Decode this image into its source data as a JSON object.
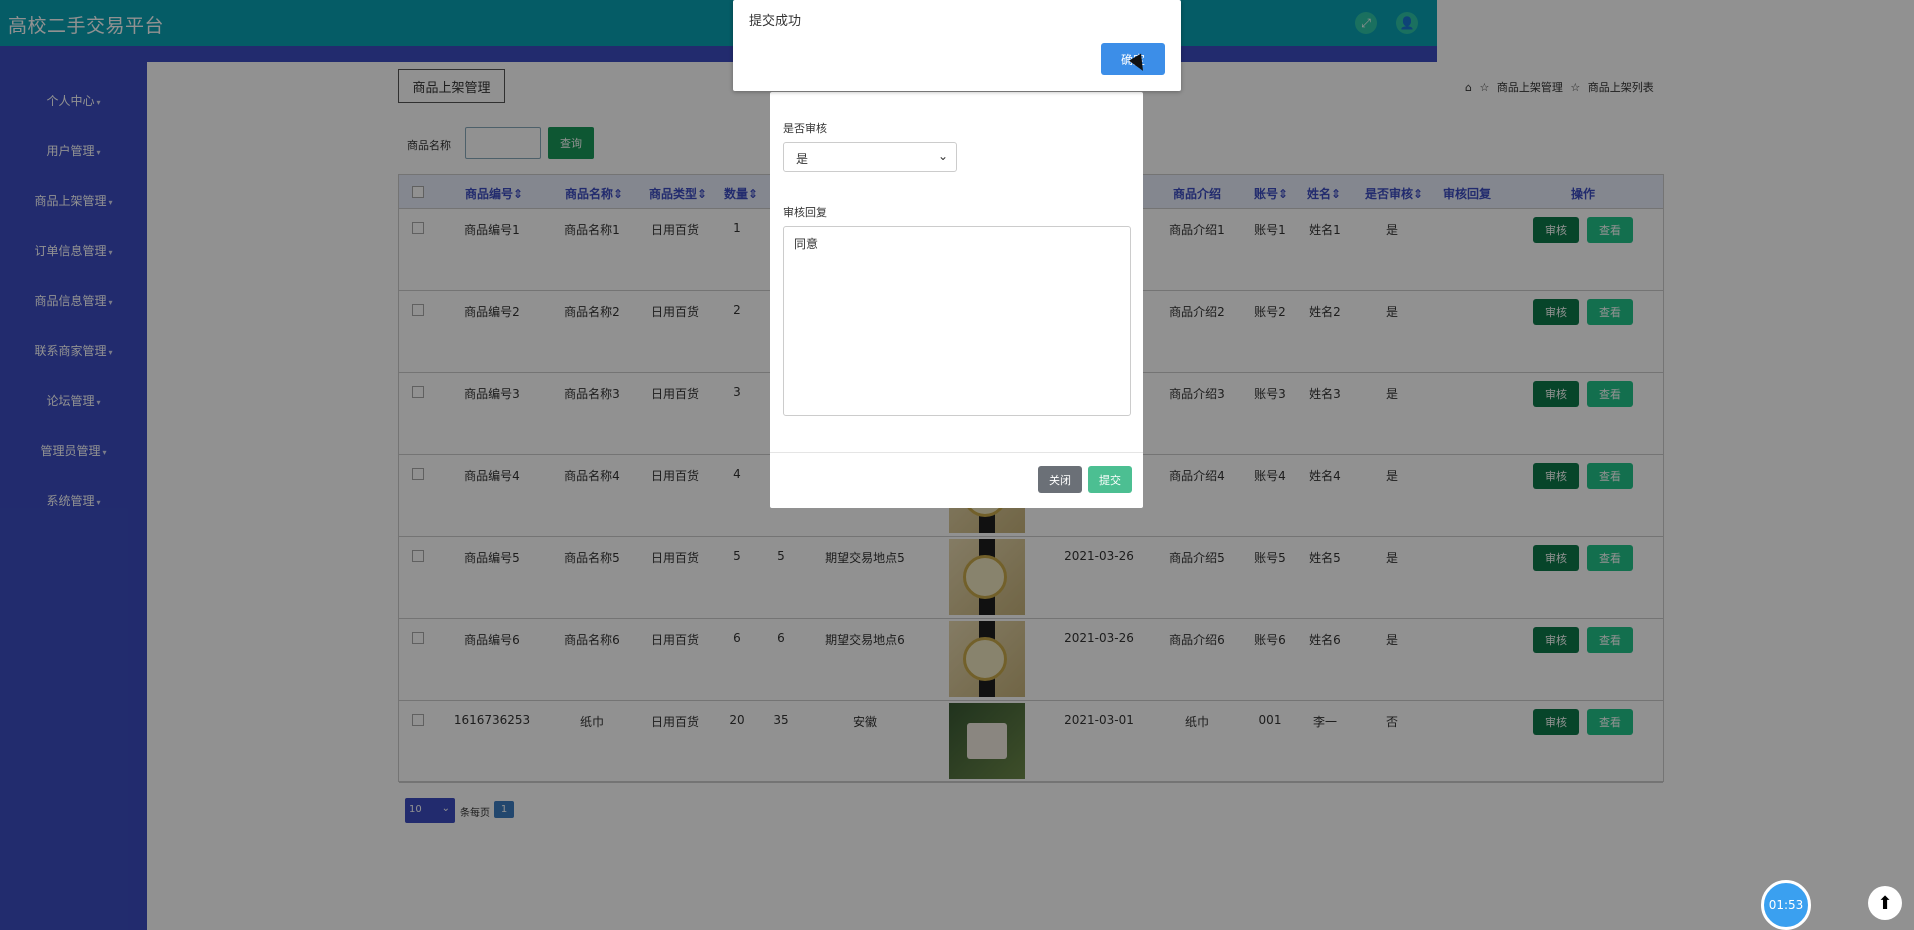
{
  "header": {
    "title": "高校二手交易平台",
    "fullscreen_icon": "fullscreen-icon",
    "user_icon": "user-icon"
  },
  "sidebar": {
    "items": [
      {
        "label": "个人中心"
      },
      {
        "label": "用户管理"
      },
      {
        "label": "商品上架管理"
      },
      {
        "label": "订单信息管理"
      },
      {
        "label": "商品信息管理"
      },
      {
        "label": "联系商家管理"
      },
      {
        "label": "论坛管理"
      },
      {
        "label": "管理员管理"
      },
      {
        "label": "系统管理"
      }
    ]
  },
  "page": {
    "section_button": "商品上架管理",
    "breadcrumb": [
      "商品上架管理",
      "商品上架列表"
    ],
    "search_label": "商品名称",
    "search_button": "查询"
  },
  "table": {
    "headers": [
      "商品编号",
      "商品名称",
      "商品类型",
      "数量",
      "商品介绍",
      "账号",
      "姓名",
      "是否审核",
      "审核回复",
      "操作"
    ],
    "rows": [
      {
        "id": "商品编号1",
        "name": "商品名称1",
        "type": "日用百货",
        "qty": "1",
        "intro": "商品介绍1",
        "account": "账号1",
        "person": "姓名1",
        "audited": "是"
      },
      {
        "id": "商品编号2",
        "name": "商品名称2",
        "type": "日用百货",
        "qty": "2",
        "intro": "商品介绍2",
        "account": "账号2",
        "person": "姓名2",
        "audited": "是"
      },
      {
        "id": "商品编号3",
        "name": "商品名称3",
        "type": "日用百货",
        "qty": "3",
        "intro": "商品介绍3",
        "account": "账号3",
        "person": "姓名3",
        "audited": "是"
      },
      {
        "id": "商品编号4",
        "name": "商品名称4",
        "type": "日用百货",
        "qty": "4",
        "intro": "商品介绍4",
        "account": "账号4",
        "person": "姓名4",
        "audited": "是"
      },
      {
        "id": "商品编号5",
        "name": "商品名称5",
        "type": "日用百货",
        "qty": "5",
        "price": "5",
        "location": "期望交易地点5",
        "date": "2021-03-26",
        "intro": "商品介绍5",
        "account": "账号5",
        "person": "姓名5",
        "audited": "是"
      },
      {
        "id": "商品编号6",
        "name": "商品名称6",
        "type": "日用百货",
        "qty": "6",
        "price": "6",
        "location": "期望交易地点6",
        "date": "2021-03-26",
        "intro": "商品介绍6",
        "account": "账号6",
        "person": "姓名6",
        "audited": "是"
      },
      {
        "id": "1616736253",
        "name": "纸巾",
        "type": "日用百货",
        "qty": "20",
        "price": "35",
        "location": "安徽",
        "date": "2021-03-01",
        "intro": "纸巾",
        "account": "001",
        "person": "李一",
        "audited": "否"
      }
    ],
    "review_button": "审核",
    "view_button": "查看"
  },
  "pagination": {
    "page_size": "10",
    "per_page_label": "条每页",
    "current_page": "1"
  },
  "modal": {
    "audit_label": "是否审核",
    "audit_value": "是",
    "reply_label": "审核回复",
    "reply_value": "同意",
    "close_button": "关闭",
    "submit_button": "提交"
  },
  "alert": {
    "message": "提交成功",
    "ok_button": "确定"
  },
  "widgets": {
    "timer": "01:53",
    "upload_icon": "upload-icon"
  }
}
